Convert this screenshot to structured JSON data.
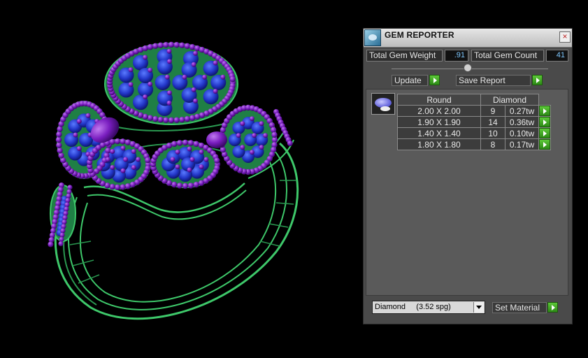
{
  "panel": {
    "title": "GEM REPORTER",
    "close_glyph": "×",
    "total_weight_label": "Total Gem Weight",
    "total_weight_value": ".91",
    "total_count_label": "Total Gem Count",
    "total_count_value": "41",
    "update_label": "Update",
    "save_report_label": "Save Report",
    "table": {
      "header_shape": "Round",
      "header_material": "Diamond",
      "rows": [
        {
          "size": "2.00 X 2.00",
          "count": "9",
          "weight": "0.27tw"
        },
        {
          "size": "1.90 X 1.90",
          "count": "14",
          "weight": "0.36tw"
        },
        {
          "size": "1.40 X 1.40",
          "count": "10",
          "weight": "0.10tw"
        },
        {
          "size": "1.80 X 1.80",
          "count": "8",
          "weight": "0.17tw"
        }
      ]
    },
    "material_select": "Diamond     (3.52 spg)",
    "set_material_label": "Set Material"
  },
  "colors": {
    "metal": "#3ec86a",
    "gem_blue": "#2a48d8",
    "bead_purple": "#7a1ec0",
    "accent_green": "#3fae22"
  },
  "icons": [
    "gem-reporter-app-icon",
    "close-icon",
    "play-arrow-icon",
    "dropdown-arrow-icon",
    "round-gem-thumbnail-icon"
  ]
}
